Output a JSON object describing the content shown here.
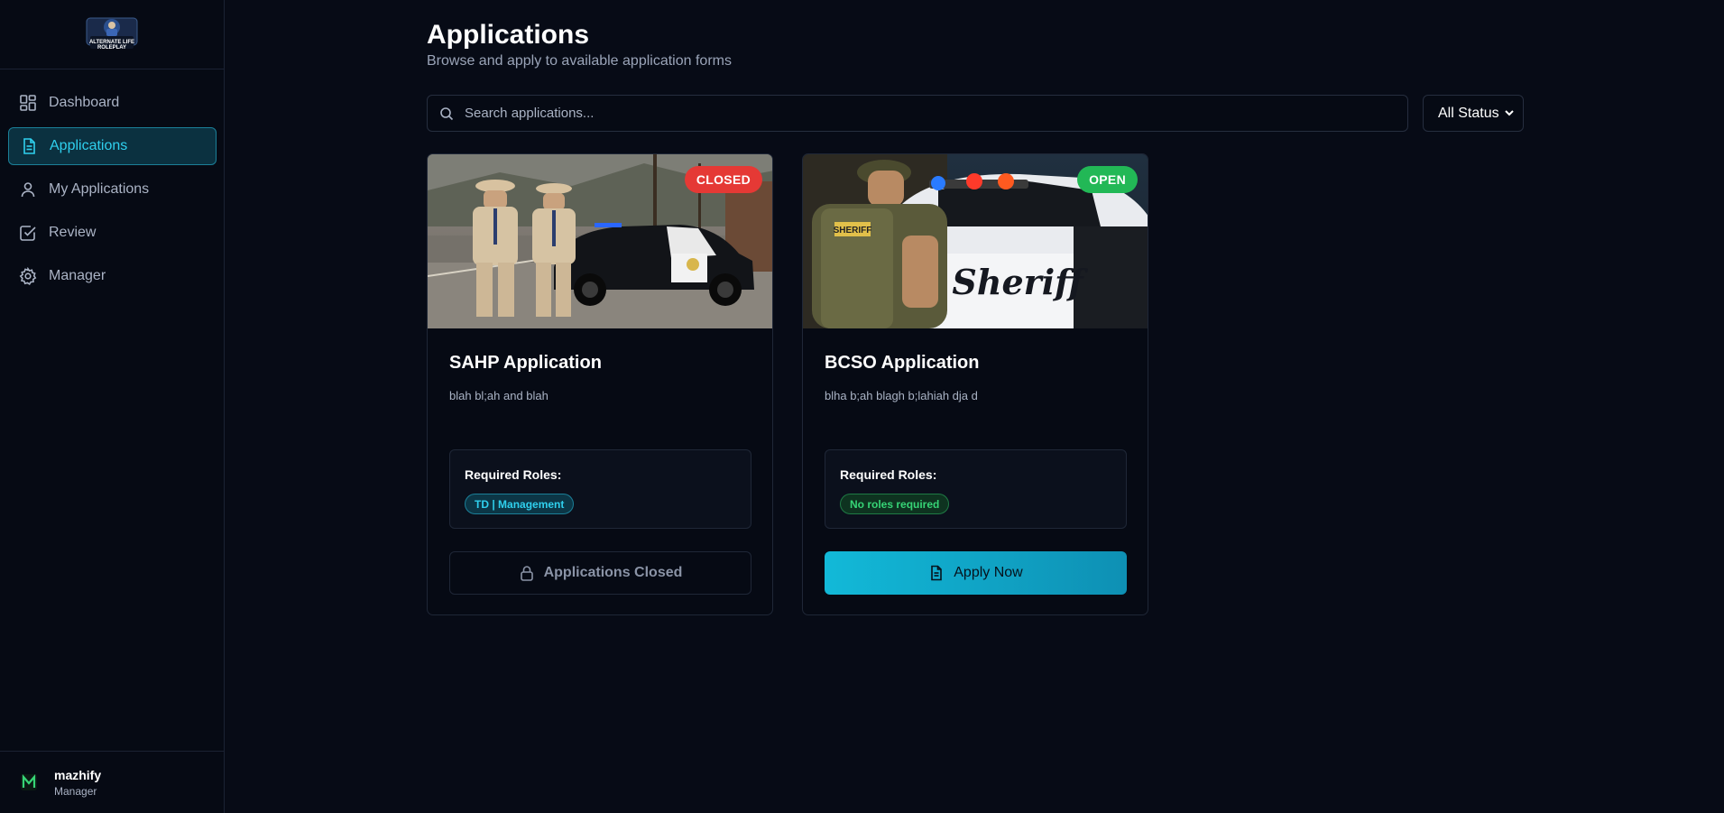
{
  "sidebar": {
    "logo_text": "ALTERNATE LIFE ROLEPLAY",
    "items": [
      {
        "label": "Dashboard",
        "icon": "dashboard-icon"
      },
      {
        "label": "Applications",
        "icon": "document-icon",
        "active": true
      },
      {
        "label": "My Applications",
        "icon": "user-icon"
      },
      {
        "label": "Review",
        "icon": "check-square-icon"
      },
      {
        "label": "Manager",
        "icon": "gear-icon"
      }
    ],
    "user": {
      "name": "mazhify",
      "role": "Manager",
      "avatar_icon": "m-logo-icon"
    }
  },
  "header": {
    "title": "Applications",
    "subtitle": "Browse and apply to available application forms"
  },
  "search": {
    "placeholder": "Search applications...",
    "value": ""
  },
  "filter": {
    "selected": "All Status"
  },
  "cards": [
    {
      "title": "SAHP Application",
      "description": "blah bl;ah and blah",
      "status": "CLOSED",
      "status_color": "#e53935",
      "roles_label": "Required Roles:",
      "role": "TD | Management",
      "button_label": "Applications Closed",
      "button_icon": "lock-icon"
    },
    {
      "title": "BCSO Application",
      "description": "blha b;ah blagh b;lahiah dja d",
      "status": "OPEN",
      "status_color": "#22b856",
      "roles_label": "Required Roles:",
      "role": "No roles required",
      "button_label": "Apply Now",
      "button_icon": "document-icon",
      "image_text": "Sheriff"
    }
  ],
  "colors": {
    "accent": "#2fd0ee",
    "background": "#070b16"
  }
}
